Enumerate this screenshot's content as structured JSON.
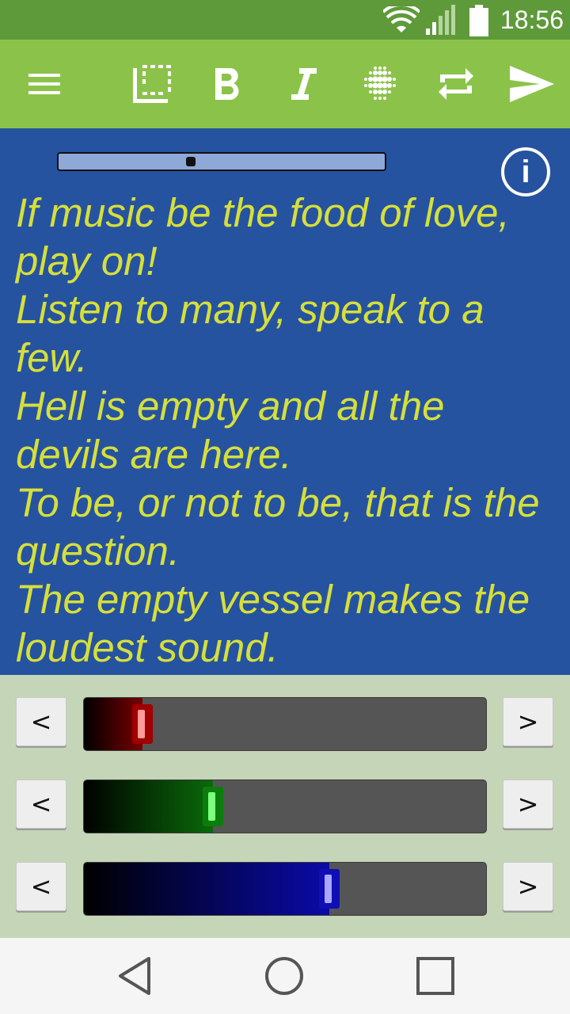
{
  "status": {
    "time": "18:56",
    "icons": [
      "wifi-icon",
      "signal-icon",
      "battery-icon"
    ]
  },
  "toolbar": {
    "background": "#8bc34a",
    "items": [
      "menu-icon",
      "select-all-icon",
      "bold-icon",
      "italic-icon",
      "dots-pattern-icon",
      "repeat-icon",
      "send-icon"
    ]
  },
  "editor": {
    "background": "#2653a0",
    "text_color": "#d6df3a",
    "lines": [
      "If music be the food of love,",
      "play on!",
      "Listen to many, speak to a",
      "few.",
      "Hell is empty and all the",
      "devils are here.",
      "To be, or not to be, that is the",
      "question.",
      "The empty vessel makes the",
      "loudest sound."
    ],
    "info_label": "i"
  },
  "sliders": {
    "decrement_label": "<",
    "increment_label": ">",
    "channels": [
      {
        "name": "red",
        "value": 0.145,
        "fill_color": "#7a0000",
        "knob_color": "#a00000",
        "knob_inner": "#ff9a9a"
      },
      {
        "name": "green",
        "value": 0.32,
        "fill_color": "#0a6a0a",
        "knob_color": "#0b7d0b",
        "knob_inner": "#7dff7d"
      },
      {
        "name": "blue",
        "value": 0.61,
        "fill_color": "#0a0aa8",
        "knob_color": "#0f0fb5",
        "knob_inner": "#a8a8ff"
      }
    ]
  },
  "nav": {
    "items": [
      "back-icon",
      "home-icon",
      "recents-icon"
    ]
  }
}
